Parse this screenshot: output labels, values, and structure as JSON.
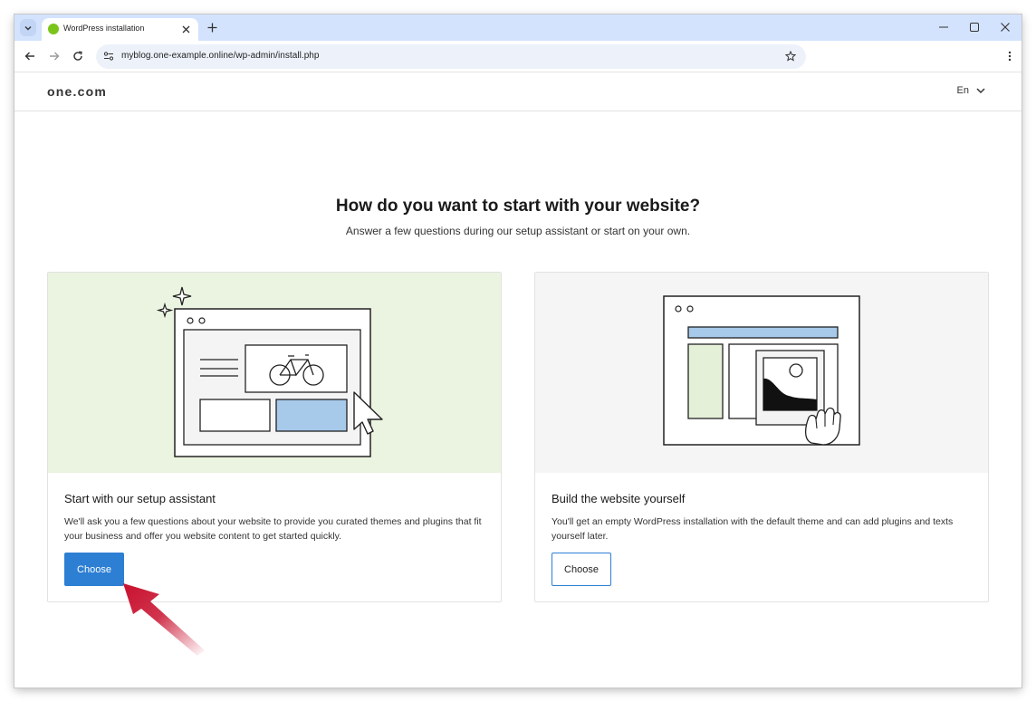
{
  "browser": {
    "tab_title": "WordPress installation",
    "url": "myblog.one-example.online/wp-admin/install.php"
  },
  "site": {
    "logo": "one.com",
    "language": "En"
  },
  "page": {
    "title": "How do you want to start with your website?",
    "subtitle": "Answer a few questions during our setup assistant or start on your own."
  },
  "cards": [
    {
      "title": "Start with our setup assistant",
      "description": "We'll ask you a few questions about your website to provide you curated themes and plugins that fit your business and offer you website content to get started quickly.",
      "button_label": "Choose"
    },
    {
      "title": "Build the website yourself",
      "description": "You'll get an empty WordPress installation with the default theme and can add plugins and texts yourself later.",
      "button_label": "Choose"
    }
  ],
  "colors": {
    "accent": "#2d7fd3",
    "tabbar": "#d3e3fd",
    "card_left_bg": "#eaf4e0",
    "card_right_bg": "#f5f5f5",
    "annotation_arrow": "#c8102e"
  },
  "icons": [
    "tab-search-icon",
    "favicon",
    "close-icon",
    "plus-icon",
    "minimize-icon",
    "maximize-icon",
    "back-icon",
    "forward-icon",
    "reload-icon",
    "site-info-icon",
    "star-icon",
    "kebab-menu-icon",
    "chevron-down-icon"
  ]
}
